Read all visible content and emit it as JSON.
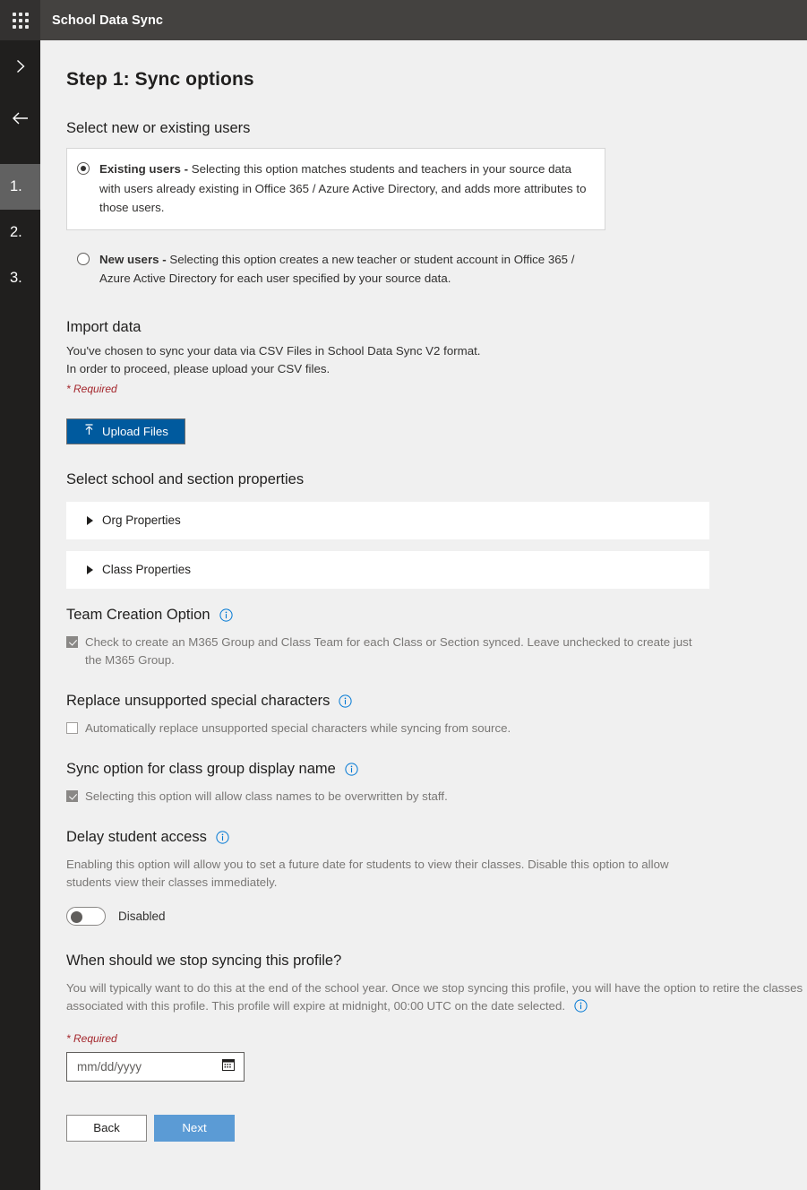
{
  "header": {
    "app_title": "School Data Sync",
    "waffle_icon": "app-launcher-waffle-icon"
  },
  "rail": {
    "expand_icon": "chevron-right-icon",
    "back_icon": "arrow-left-icon",
    "steps": [
      {
        "label": "1.",
        "active": true
      },
      {
        "label": "2.",
        "active": false
      },
      {
        "label": "3.",
        "active": false
      }
    ]
  },
  "page": {
    "title": "Step 1: Sync options"
  },
  "user_selection": {
    "heading": "Select new or existing users",
    "options": [
      {
        "title": "Existing users - ",
        "description": "Selecting this option matches students and teachers in your source data with users already existing in Office 365 / Azure Active Directory, and adds more attributes to those users.",
        "selected": true
      },
      {
        "title": "New users - ",
        "description": "Selecting this option creates a new teacher or student account in Office 365 / Azure Active Directory for each user specified by your source data.",
        "selected": false
      }
    ]
  },
  "import_data": {
    "heading": "Import data",
    "line1": "You've chosen to sync your data via CSV Files in School Data Sync V2 format.",
    "line2": "In order to proceed, please upload your CSV files.",
    "required": "* Required",
    "upload_button": "Upload Files",
    "upload_icon": "upload-arrow-icon"
  },
  "properties": {
    "heading": "Select school and section properties",
    "items": [
      {
        "label": "Org Properties"
      },
      {
        "label": "Class Properties"
      }
    ]
  },
  "team_creation": {
    "heading": "Team Creation Option",
    "info_icon": "info-circle-icon",
    "checkbox_label": "Check to create an M365 Group and Class Team for each Class or Section synced. Leave unchecked to create just the M365 Group.",
    "checked": true
  },
  "special_characters": {
    "heading": "Replace unsupported special characters",
    "info_icon": "info-circle-icon",
    "checkbox_label": "Automatically replace unsupported special characters while syncing from source.",
    "checked": false
  },
  "class_group_display_name": {
    "heading": "Sync option for class group display name",
    "info_icon": "info-circle-icon",
    "checkbox_label": "Selecting this option will allow class names to be overwritten by staff.",
    "checked": true
  },
  "delay_student_access": {
    "heading": "Delay student access",
    "info_icon": "info-circle-icon",
    "description": "Enabling this option will allow you to set a future date for students to view their classes. Disable this option to allow students view their classes immediately.",
    "toggle_state_label": "Disabled",
    "toggle_on": false
  },
  "stop_syncing": {
    "heading": "When should we stop syncing this profile?",
    "description": "You will typically want to do this at the end of the school year. Once we stop syncing this profile, you will have the option to retire the classes associated with this profile. This profile will expire at midnight, 00:00 UTC on the date selected.",
    "info_icon": "info-circle-icon",
    "required": "* Required",
    "date_placeholder": "mm/dd/yyyy",
    "date_value": "",
    "calendar_icon": "calendar-icon"
  },
  "footer": {
    "back_label": "Back",
    "next_label": "Next"
  },
  "colors": {
    "header_bg": "#444240",
    "rail_bg": "#201f1e",
    "rail_active_bg": "#616161",
    "page_bg": "#f0f0f0",
    "primary_button": "#005a9e",
    "next_button": "#5b9bd5",
    "required_text": "#a4262c",
    "info_icon": "#0078d4"
  }
}
